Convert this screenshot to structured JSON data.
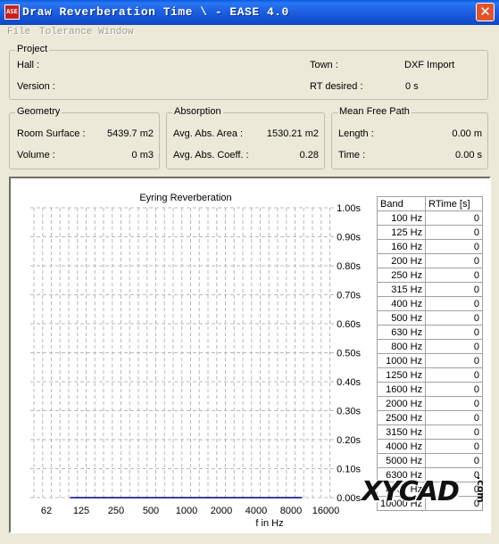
{
  "window": {
    "title": "Draw Reverberation Time \\ - EASE 4.0",
    "icon_text": "ASE",
    "close_glyph": "✕"
  },
  "menu": [
    "File",
    "Tolerance",
    "Window"
  ],
  "project": {
    "label": "Project",
    "hall_label": "Hall :",
    "version_label": "Version :",
    "town_label": "Town :",
    "town_value": "DXF Import",
    "rt_desired_label": "RT desired :",
    "rt_desired_value": "0 s"
  },
  "geometry": {
    "label": "Geometry",
    "room_surface_label": "Room Surface :",
    "room_surface_value": "5439.7 m2",
    "volume_label": "Volume :",
    "volume_value": "0 m3"
  },
  "absorption": {
    "label": "Absorption",
    "area_label": "Avg. Abs. Area :",
    "area_value": "1530.21 m2",
    "coeff_label": "Avg. Abs. Coeff. :",
    "coeff_value": "0.28"
  },
  "mean_free_path": {
    "label": "Mean Free Path",
    "length_label": "Length :",
    "length_value": "0.00 m",
    "time_label": "Time :",
    "time_value": "0.00 s"
  },
  "chart_data": {
    "type": "line",
    "title": "Eyring Reverberation",
    "xlabel": "f in Hz",
    "x_ticks": [
      "62",
      "125",
      "250",
      "500",
      "1000",
      "2000",
      "4000",
      "8000",
      "16000"
    ],
    "y_ticks": [
      "0.00s",
      "0.10s",
      "0.20s",
      "0.30s",
      "0.40s",
      "0.50s",
      "0.60s",
      "0.70s",
      "0.80s",
      "0.90s",
      "1.00s"
    ],
    "ylim": [
      0,
      1.0
    ],
    "grid": true,
    "line_color": "#000080",
    "series": [
      {
        "x": [
          100,
          125,
          160,
          200,
          250,
          315,
          400,
          500,
          630,
          800,
          1000,
          1250,
          1600,
          2000,
          2500,
          3150,
          4000,
          5000,
          6300,
          8000,
          10000
        ],
        "values": [
          0,
          0,
          0,
          0,
          0,
          0,
          0,
          0,
          0,
          0,
          0,
          0,
          0,
          0,
          0,
          0,
          0,
          0,
          0,
          0,
          0
        ]
      }
    ]
  },
  "table": {
    "headers": [
      "Band",
      "RTime [s]"
    ],
    "rows": [
      [
        "100 Hz",
        "0"
      ],
      [
        "125 Hz",
        "0"
      ],
      [
        "160 Hz",
        "0"
      ],
      [
        "200 Hz",
        "0"
      ],
      [
        "250 Hz",
        "0"
      ],
      [
        "315 Hz",
        "0"
      ],
      [
        "400 Hz",
        "0"
      ],
      [
        "500 Hz",
        "0"
      ],
      [
        "630 Hz",
        "0"
      ],
      [
        "800 Hz",
        "0"
      ],
      [
        "1000 Hz",
        "0"
      ],
      [
        "1250 Hz",
        "0"
      ],
      [
        "1600 Hz",
        "0"
      ],
      [
        "2000 Hz",
        "0"
      ],
      [
        "2500 Hz",
        "0"
      ],
      [
        "3150 Hz",
        "0"
      ],
      [
        "4000 Hz",
        "0"
      ],
      [
        "5000 Hz",
        "0"
      ],
      [
        "6300 Hz",
        "0"
      ],
      [
        "8000 Hz",
        "0"
      ],
      [
        "10000 Hz",
        "0"
      ]
    ]
  },
  "watermark": {
    "text": "XYCAD",
    "suffix": ".com"
  }
}
